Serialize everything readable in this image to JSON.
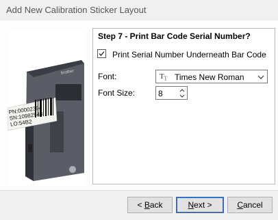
{
  "window": {
    "title": "Add New Calibration Sticker Layout"
  },
  "panel": {
    "step_title": "Step 7 - Print Bar Code Serial Number?",
    "checkbox": {
      "label": "Print Serial Number Underneath Bar Code",
      "checked": true
    },
    "font": {
      "label": "Font:",
      "value": "Times New Roman"
    },
    "font_size": {
      "label": "Font Size:",
      "value": "8"
    }
  },
  "image": {
    "label_lines": [
      "PN:00002394",
      "SN:10982543",
      "LO:54B2"
    ],
    "brand": "brother"
  },
  "buttons": {
    "back": {
      "pre": "< ",
      "accel": "B",
      "post": "ack"
    },
    "next": {
      "accel": "N",
      "post": "ext >"
    },
    "cancel": {
      "accel": "C",
      "post": "ancel"
    }
  },
  "colors": {
    "default_button_border": "#3c6fb4",
    "printer_body": "#4a4d55"
  }
}
